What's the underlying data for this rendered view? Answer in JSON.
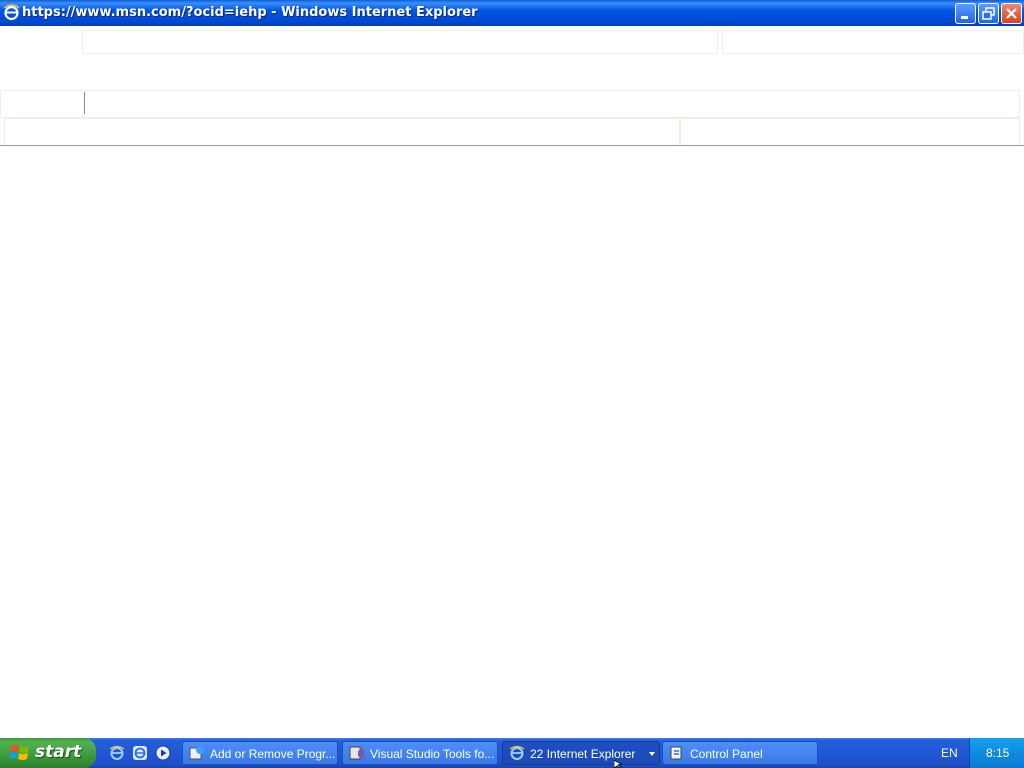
{
  "window": {
    "title": "https://www.msn.com/?ocid=iehp - Windows Internet Explorer",
    "icon": "ie-icon",
    "controls": [
      "minimize",
      "restore",
      "close"
    ]
  },
  "taskbar": {
    "start_label": "start",
    "quick_launch": [
      "ie-icon",
      "ie-icon-alt",
      "media-player-icon"
    ],
    "buttons": [
      {
        "label": "Add or Remove Progr...",
        "icon": "add-remove-programs-icon",
        "active": false
      },
      {
        "label": "Visual Studio Tools fo...",
        "icon": "visual-studio-icon",
        "active": false
      },
      {
        "label": "22 Internet Explorer",
        "icon": "ie-icon",
        "active": true,
        "grouped": true
      },
      {
        "label": "Control Panel",
        "icon": "control-panel-icon",
        "active": false
      }
    ],
    "language": "EN",
    "clock": "8:15"
  },
  "colors": {
    "titlebar": "#0055e5",
    "taskbar": "#245edb",
    "start": "#3b9a3b",
    "tray": "#0f8ce0",
    "page": "#ffffff"
  }
}
